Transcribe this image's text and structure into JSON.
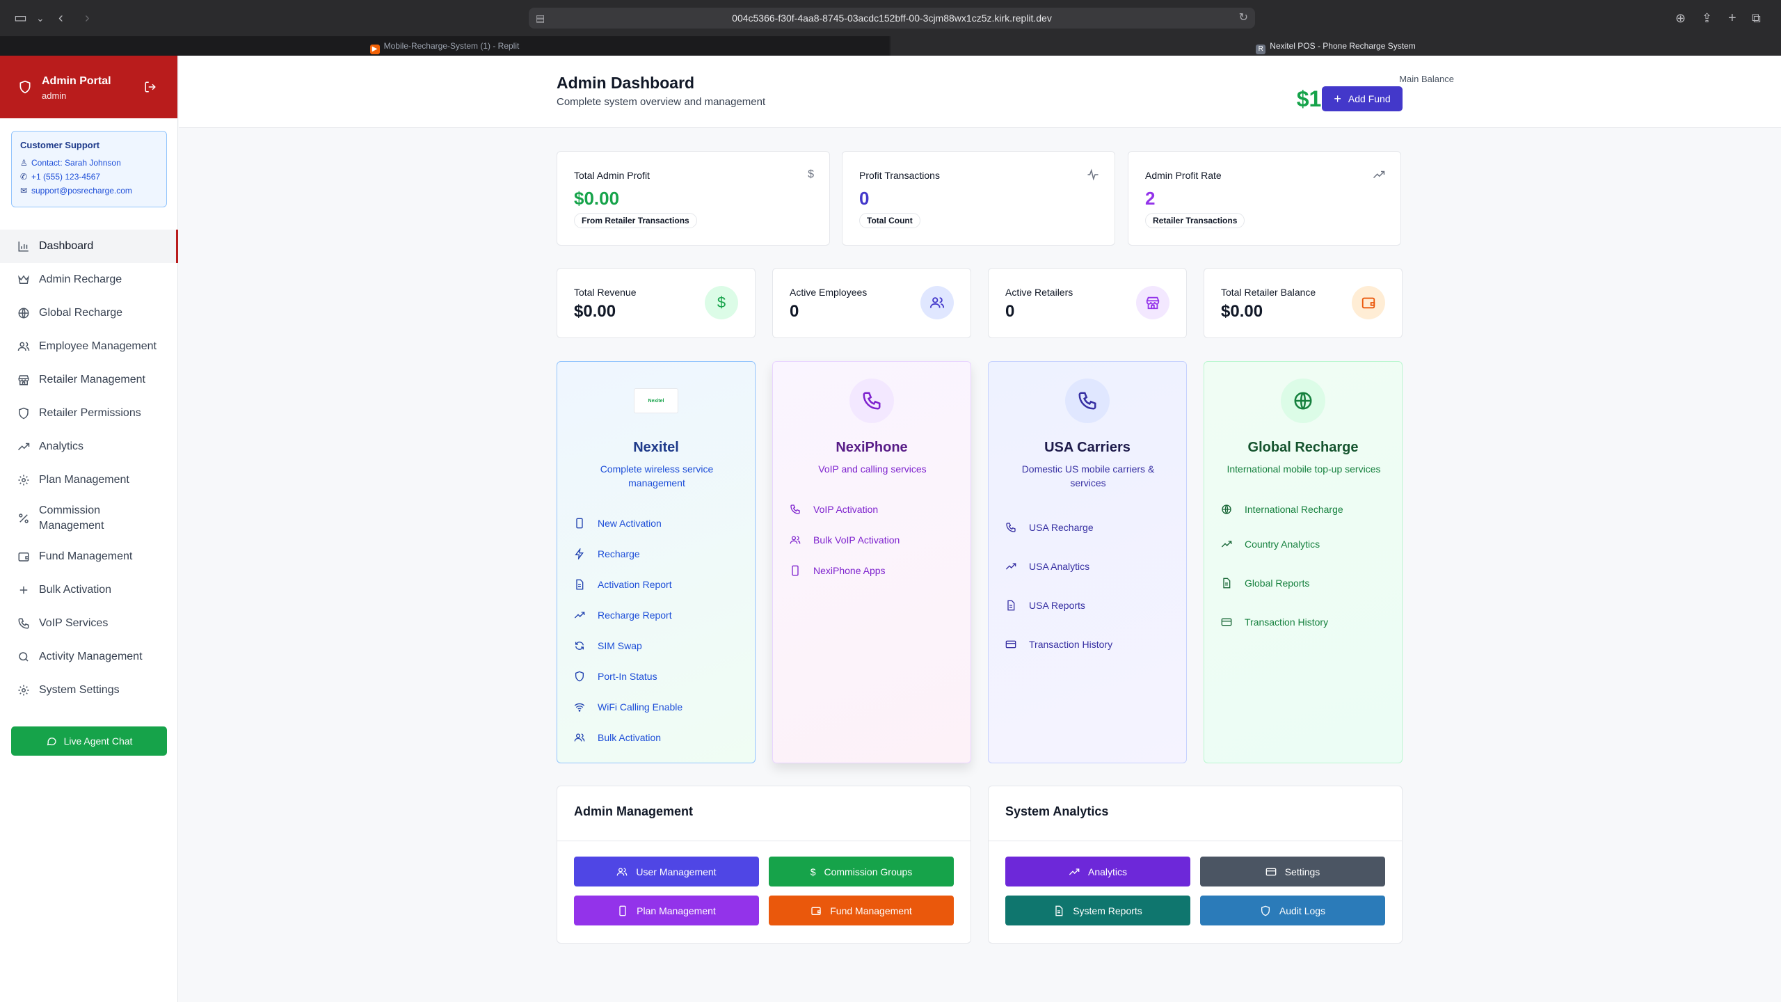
{
  "browser": {
    "url": "004c5366-f30f-4aa8-8745-03acdc152bff-00-3cjm88wx1cz5z.kirk.replit.dev",
    "tabs": [
      {
        "label": "Mobile-Recharge-System (1) - Replit"
      },
      {
        "label": "Nexitel POS - Phone Recharge System"
      }
    ]
  },
  "sidebar": {
    "portal_title": "Admin Portal",
    "portal_user": "admin",
    "support": {
      "title": "Customer Support",
      "contact": "Contact: Sarah Johnson",
      "phone": "+1 (555) 123-4567",
      "email": "support@posrecharge.com"
    },
    "items": [
      {
        "label": "Dashboard",
        "icon": "bar-chart-icon"
      },
      {
        "label": "Admin Recharge",
        "icon": "crown-icon"
      },
      {
        "label": "Global Recharge",
        "icon": "globe-icon"
      },
      {
        "label": "Employee Management",
        "icon": "users-icon"
      },
      {
        "label": "Retailer Management",
        "icon": "store-icon"
      },
      {
        "label": "Retailer Permissions",
        "icon": "shield-icon"
      },
      {
        "label": "Analytics",
        "icon": "trending-up-icon"
      },
      {
        "label": "Plan Management",
        "icon": "gear-icon"
      },
      {
        "label": "Commission Management",
        "icon": "percent-icon"
      },
      {
        "label": "Fund Management",
        "icon": "wallet-icon"
      },
      {
        "label": "Bulk Activation",
        "icon": "plus-icon"
      },
      {
        "label": "VoIP Services",
        "icon": "phone-icon"
      },
      {
        "label": "Activity Management",
        "icon": "search-icon"
      },
      {
        "label": "System Settings",
        "icon": "gear-icon"
      }
    ],
    "live_chat": "Live Agent Chat"
  },
  "header": {
    "title": "Admin Dashboard",
    "subtitle": "Complete system overview and management",
    "balance_label": "Main Balance",
    "balance_value": "$10000.00",
    "add_fund": "Add Fund"
  },
  "stats_top": [
    {
      "label": "Total Admin Profit",
      "value": "$0.00",
      "badge": "From Retailer Transactions",
      "color": "#16a34a",
      "icon": "dollar-icon"
    },
    {
      "label": "Profit Transactions",
      "value": "0",
      "badge": "Total Count",
      "color": "#4338ca",
      "icon": "activity-icon"
    },
    {
      "label": "Admin Profit Rate",
      "value": "2",
      "badge": "Retailer Transactions",
      "color": "#9333ea",
      "icon": "trending-up-icon"
    }
  ],
  "stats_mid": [
    {
      "label": "Total Revenue",
      "value": "$0.00",
      "icon": "dollar-icon"
    },
    {
      "label": "Active Employees",
      "value": "0",
      "icon": "users-icon"
    },
    {
      "label": "Active Retailers",
      "value": "0",
      "icon": "store-icon"
    },
    {
      "label": "Total Retailer Balance",
      "value": "$0.00",
      "icon": "wallet-icon"
    }
  ],
  "services": [
    {
      "title": "Nexitel",
      "desc": "Complete wireless service management",
      "logo_text": "Nexitel",
      "items": [
        {
          "label": "New Activation",
          "icon": "smartphone-icon"
        },
        {
          "label": "Recharge",
          "icon": "zap-icon"
        },
        {
          "label": "Activation Report",
          "icon": "file-icon"
        },
        {
          "label": "Recharge Report",
          "icon": "trending-up-icon"
        },
        {
          "label": "SIM Swap",
          "icon": "refresh-icon"
        },
        {
          "label": "Port-In Status",
          "icon": "shield-icon"
        },
        {
          "label": "WiFi Calling Enable",
          "icon": "wifi-icon"
        },
        {
          "label": "Bulk Activation",
          "icon": "users-icon"
        }
      ]
    },
    {
      "title": "NexiPhone",
      "desc": "VoIP and calling services",
      "items": [
        {
          "label": "VoIP Activation",
          "icon": "phone-icon"
        },
        {
          "label": "Bulk VoIP Activation",
          "icon": "users-icon"
        },
        {
          "label": "NexiPhone Apps",
          "icon": "smartphone-icon"
        }
      ]
    },
    {
      "title": "USA Carriers",
      "desc": "Domestic US mobile carriers & services",
      "items": [
        {
          "label": "USA Recharge",
          "icon": "phone-icon"
        },
        {
          "label": "USA Analytics",
          "icon": "trending-up-icon"
        },
        {
          "label": "USA Reports",
          "icon": "file-icon"
        },
        {
          "label": "Transaction History",
          "icon": "card-icon"
        }
      ]
    },
    {
      "title": "Global Recharge",
      "desc": "International mobile top-up services",
      "items": [
        {
          "label": "International Recharge",
          "icon": "globe-icon"
        },
        {
          "label": "Country Analytics",
          "icon": "trending-up-icon"
        },
        {
          "label": "Global Reports",
          "icon": "file-icon"
        },
        {
          "label": "Transaction History",
          "icon": "card-icon"
        }
      ]
    }
  ],
  "admin_management": {
    "title": "Admin Management",
    "buttons": [
      {
        "label": "User Management",
        "color": "#4f46e5",
        "icon": "users-icon"
      },
      {
        "label": "Commission Groups",
        "color": "#16a34a",
        "icon": "dollar-icon"
      },
      {
        "label": "Plan Management",
        "color": "#9333ea",
        "icon": "smartphone-icon"
      },
      {
        "label": "Fund Management",
        "color": "#ea580c",
        "icon": "wallet-icon"
      }
    ]
  },
  "system_analytics": {
    "title": "System Analytics",
    "buttons": [
      {
        "label": "Analytics",
        "color": "#6d28d9",
        "icon": "trending-up-icon"
      },
      {
        "label": "Settings",
        "color": "#4b5563",
        "icon": "card-icon"
      },
      {
        "label": "System Reports",
        "color": "#0f766e",
        "icon": "file-icon"
      },
      {
        "label": "Audit Logs",
        "color": "#2b7bb9",
        "icon": "shield-icon"
      }
    ]
  }
}
